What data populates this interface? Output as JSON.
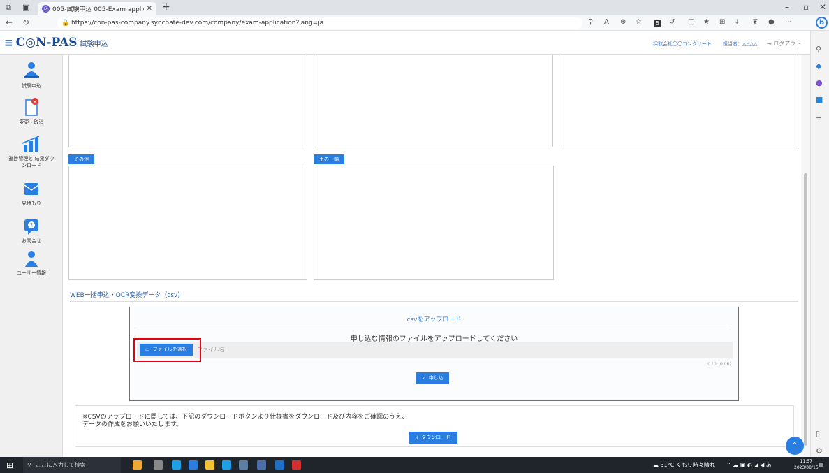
{
  "browser": {
    "tab_title": "005-試験申込 005-Exam applica",
    "url": "https://con-pas-company.synchate-dev.com/company/exam-application?lang=ja"
  },
  "header": {
    "logo": "C◎N-PAS",
    "subtitle": "試験申込",
    "company": "採取会社〇〇コンクリート",
    "person": "担当者：△△△△",
    "logout": "ログアウト"
  },
  "sidebar": {
    "items": [
      {
        "label": "試験申込",
        "color": "#2a7de1"
      },
      {
        "label": "変更・取消",
        "color": "#2a7de1"
      },
      {
        "label": "進捗管理と 結果ダウンロード",
        "color": "#2a7de1"
      },
      {
        "label": "見積もり",
        "color": "#2a7de1"
      },
      {
        "label": "お問合せ",
        "color": "#2a7de1"
      },
      {
        "label": "ユーザー情報",
        "color": "#2a7de1"
      }
    ]
  },
  "panels": {
    "tag_other": "その他",
    "tag_soil": "土の一軸"
  },
  "bulk": {
    "section_title": "WEB一括申込・OCR変換データ（csv）",
    "upload_title": "csvをアップロード",
    "upload_message": "申し込む情報のファイルをアップロードしてください",
    "file_button": "ファイルを選択",
    "file_placeholder": "ファイル名",
    "counter": "0 / 1 (0.0B)",
    "apply_button": "申し込",
    "note_line1": "※CSVのアップロードに関しては、下記のダウンロードボタンより仕様書をダウンロード及び内容をご確認のうえ、",
    "note_line2": "データの作成をお願いいたします。",
    "download_button": "ダウンロード"
  },
  "taskbar": {
    "search_placeholder": "ここに入力して検索",
    "weather": "31°C くもり時々晴れ",
    "time": "11:57",
    "date": "2023/08/16"
  },
  "colors": {
    "accent": "#2a7de1",
    "highlight": "#e60012"
  }
}
